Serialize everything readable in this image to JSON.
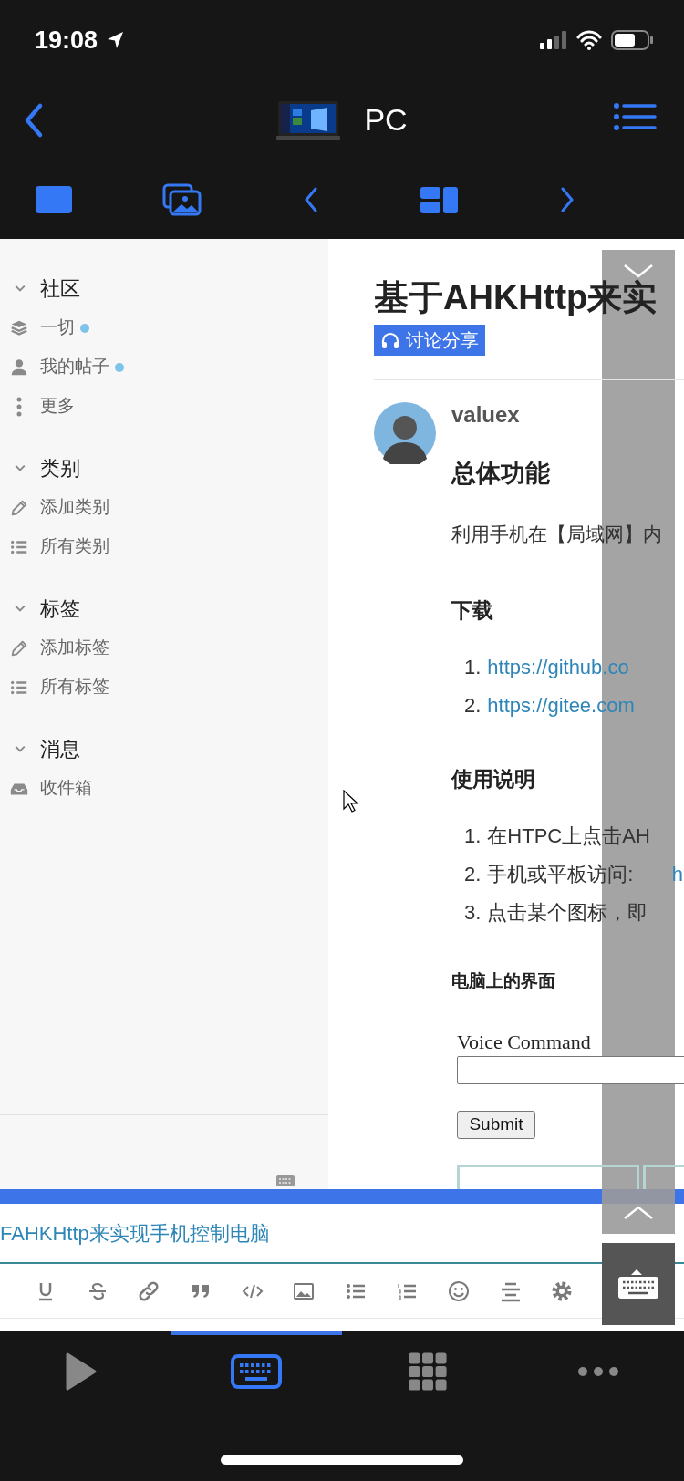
{
  "status_bar": {
    "time": "19:08"
  },
  "nav": {
    "title": "PC"
  },
  "remote": {
    "sidebar": {
      "sections": [
        {
          "title": "社区",
          "expanded": true,
          "items": [
            {
              "kind": "layers",
              "label": "一切",
              "unread": true
            },
            {
              "kind": "person",
              "label": "我的帖子",
              "unread": true
            },
            {
              "kind": "more",
              "label": "更多",
              "unread": false
            }
          ]
        },
        {
          "title": "类别",
          "expanded": true,
          "items": [
            {
              "kind": "pencil",
              "label": "添加类别",
              "unread": false
            },
            {
              "kind": "list",
              "label": "所有类别",
              "unread": false
            }
          ]
        },
        {
          "title": "标签",
          "expanded": true,
          "items": [
            {
              "kind": "pencil",
              "label": "添加标签",
              "unread": false
            },
            {
              "kind": "list",
              "label": "所有标签",
              "unread": false
            }
          ]
        },
        {
          "title": "消息",
          "expanded": true,
          "items": [
            {
              "kind": "inbox",
              "label": "收件箱",
              "unread": false
            }
          ]
        }
      ]
    },
    "article": {
      "title": "基于AHKHttp来实",
      "tag": "讨论分享",
      "author": "valuex",
      "blocks": [
        {
          "kind": "h2",
          "text": "总体功能"
        },
        {
          "kind": "p",
          "text": "利用手机在【局域网】内"
        },
        {
          "kind": "h3",
          "text": "下载"
        },
        {
          "kind": "ol",
          "items": [
            {
              "number": "1.",
              "link": "https://github.co"
            },
            {
              "number": "2.",
              "link": "https://gitee.com"
            }
          ]
        },
        {
          "kind": "h3",
          "text": "使用说明"
        },
        {
          "kind": "ol",
          "items": [
            {
              "number": "1.",
              "text": "在HTPC上点击AH"
            },
            {
              "number": "2.",
              "text": "手机或平板访问: ",
              "link": "h"
            },
            {
              "number": "3.",
              "text": "点击某个图标，即"
            }
          ]
        },
        {
          "kind": "h4",
          "text": "电脑上的界面"
        },
        {
          "kind": "form",
          "label": "Voice Command",
          "button": "Submit"
        }
      ]
    },
    "editor": {
      "title_value": "FAHKHttp来实现手机控制电脑"
    }
  },
  "tab_bar": [
    {
      "selected": false
    },
    {
      "selected": true
    },
    {
      "selected": false
    },
    {
      "selected": false
    }
  ]
}
